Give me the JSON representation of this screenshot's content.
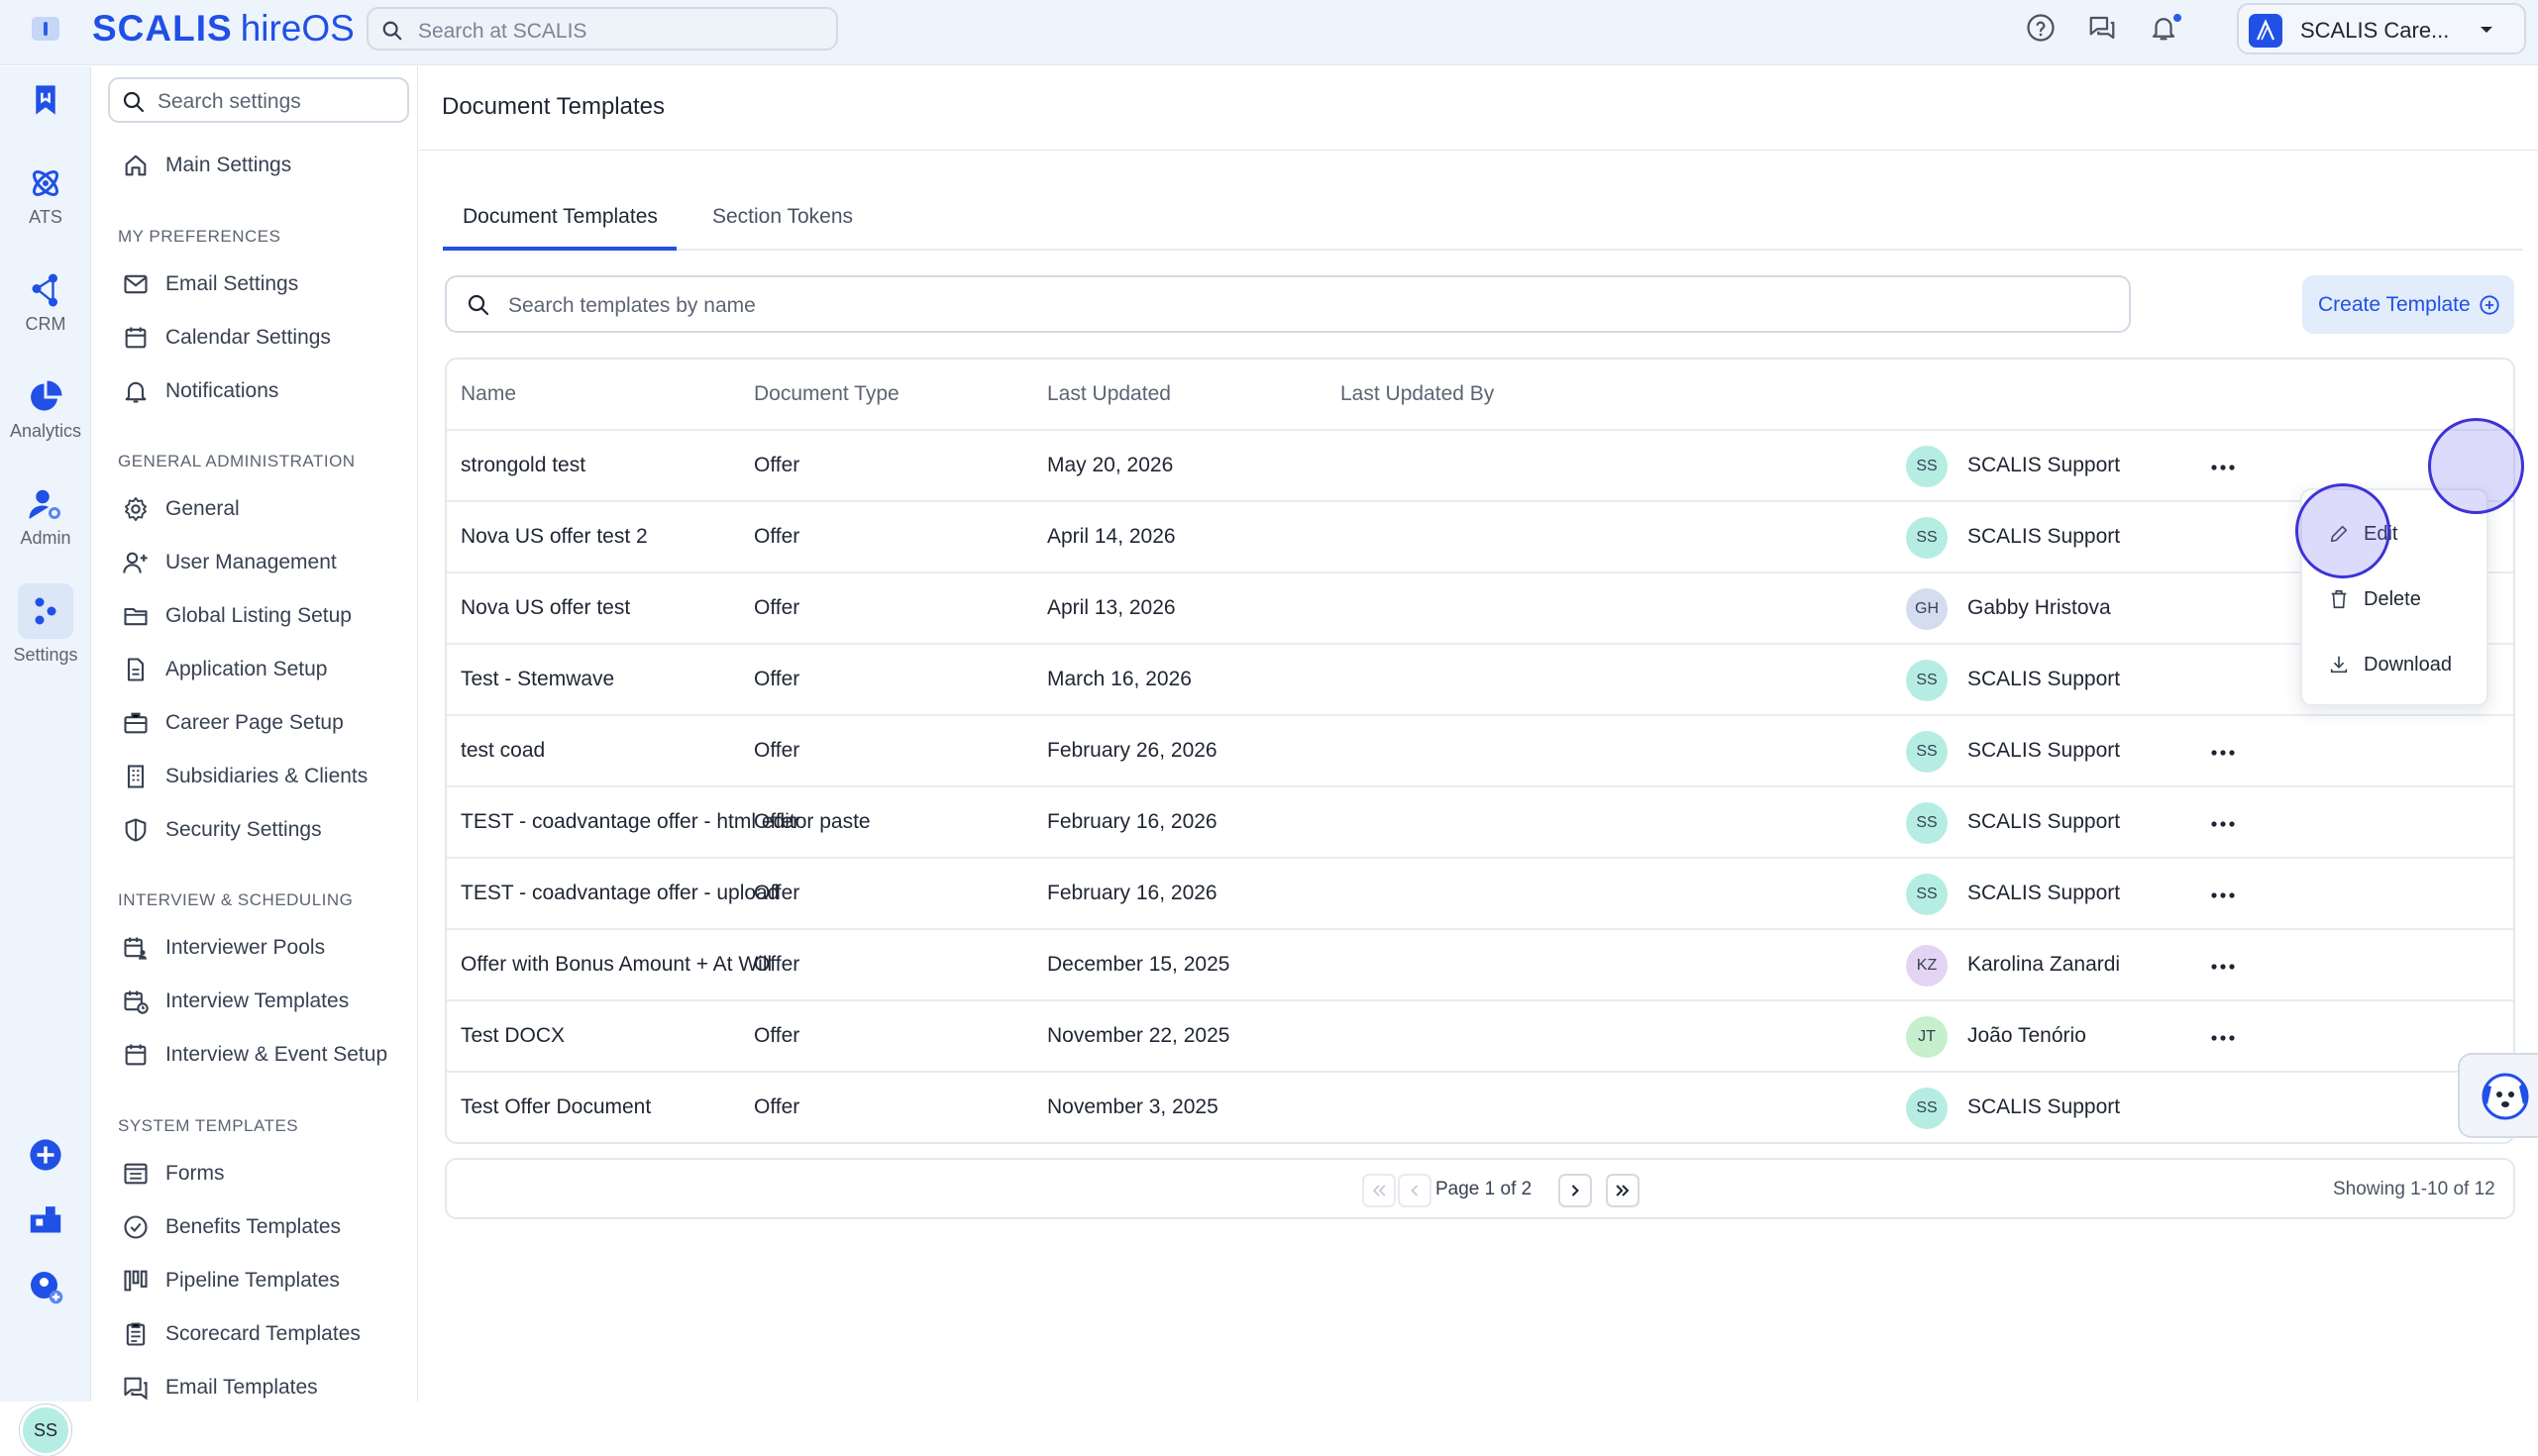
{
  "app": {
    "logo_main": "SCALIS",
    "logo_product": "hireOS"
  },
  "topbar": {
    "search_placeholder": "Search at SCALIS",
    "account_name": "SCALIS Care..."
  },
  "rail": {
    "items": [
      {
        "label": ""
      },
      {
        "label": "ATS"
      },
      {
        "label": "CRM"
      },
      {
        "label": "Analytics"
      },
      {
        "label": "Admin"
      },
      {
        "label": "Settings"
      }
    ],
    "user_initials": "SS"
  },
  "sidebar": {
    "search_placeholder": "Search settings",
    "main_settings": "Main Settings",
    "sections": [
      {
        "title": "MY PREFERENCES",
        "items": [
          "Email Settings",
          "Calendar Settings",
          "Notifications"
        ]
      },
      {
        "title": "GENERAL ADMINISTRATION",
        "items": [
          "General",
          "User Management",
          "Global Listing Setup",
          "Application Setup",
          "Career Page Setup",
          "Subsidiaries & Clients",
          "Security Settings"
        ]
      },
      {
        "title": "INTERVIEW & SCHEDULING",
        "items": [
          "Interviewer Pools",
          "Interview Templates",
          "Interview & Event Setup"
        ]
      },
      {
        "title": "SYSTEM TEMPLATES",
        "items": [
          "Forms",
          "Benefits Templates",
          "Pipeline Templates",
          "Scorecard Templates",
          "Email Templates"
        ]
      }
    ]
  },
  "page": {
    "title": "Document Templates",
    "tabs": [
      "Document Templates",
      "Section Tokens"
    ],
    "search_placeholder": "Search templates by name",
    "create_label": "Create Template"
  },
  "table": {
    "headers": [
      "Name",
      "Document Type",
      "Last Updated",
      "Last Updated By"
    ],
    "rows": [
      {
        "name": "strongold test",
        "type": "Offer",
        "updated": "May 20, 2026",
        "initials": "SS",
        "by": "SCALIS Support"
      },
      {
        "name": "Nova US offer test 2",
        "type": "Offer",
        "updated": "April 14, 2026",
        "initials": "SS",
        "by": "SCALIS Support"
      },
      {
        "name": "Nova US offer test",
        "type": "Offer",
        "updated": "April 13, 2026",
        "initials": "GH",
        "by": "Gabby Hristova"
      },
      {
        "name": "Test - Stemwave",
        "type": "Offer",
        "updated": "March 16, 2026",
        "initials": "SS",
        "by": "SCALIS Support"
      },
      {
        "name": "test coad",
        "type": "Offer",
        "updated": "February 26, 2026",
        "initials": "SS",
        "by": "SCALIS Support"
      },
      {
        "name": "TEST - coadvantage offer - html editor paste",
        "type": "Offer",
        "updated": "February 16, 2026",
        "initials": "SS",
        "by": "SCALIS Support"
      },
      {
        "name": "TEST - coadvantage offer - upload",
        "type": "Offer",
        "updated": "February 16, 2026",
        "initials": "SS",
        "by": "SCALIS Support"
      },
      {
        "name": "Offer with Bonus Amount + At Will",
        "type": "Offer",
        "updated": "December 15, 2025",
        "initials": "KZ",
        "by": "Karolina Zanardi"
      },
      {
        "name": "Test DOCX",
        "type": "Offer",
        "updated": "November 22, 2025",
        "initials": "JT",
        "by": "João Tenório"
      },
      {
        "name": "Test Offer Document",
        "type": "Offer",
        "updated": "November 3, 2025",
        "initials": "SS",
        "by": "SCALIS Support"
      }
    ]
  },
  "pagination": {
    "page_text": "Page 1 of 2",
    "showing": "Showing 1-10 of 12"
  },
  "row_menu": {
    "items": [
      "Edit",
      "Delete",
      "Download"
    ]
  },
  "colors": {
    "accent": "#2050e6",
    "avatar_ss": "#b5ede3",
    "avatar_gh": "#d4dcef",
    "avatar_kz": "#e3d4f3",
    "avatar_jt": "#c5efcd"
  }
}
